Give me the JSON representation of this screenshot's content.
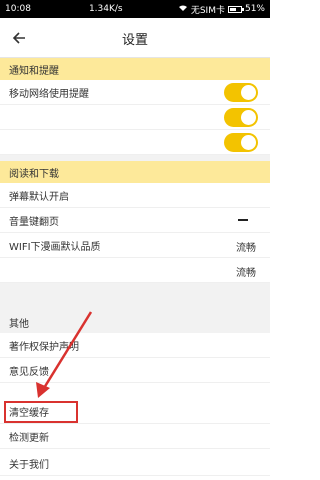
{
  "status_bar": {
    "time": "10:08",
    "network": "1.34K/s",
    "carrier": "无SIM卡",
    "battery": "51%",
    "battery_level": 0.51
  },
  "header": {
    "title": "设置",
    "back_icon": "back-arrow-icon"
  },
  "sections": {
    "notifications": {
      "header": "通知和提醒",
      "items": [
        {
          "label": "移动网络使用提醒",
          "toggle": true
        },
        {
          "label": "",
          "toggle": true
        },
        {
          "label": "",
          "toggle": true
        }
      ]
    },
    "reading": {
      "header": "阅读和下载",
      "items": [
        {
          "label": "弹幕默认开启",
          "value": ""
        },
        {
          "label": "音量键翻页",
          "value": ""
        },
        {
          "label": "WIFI下漫画默认品质",
          "value": "流畅"
        },
        {
          "label": "",
          "value": "流畅"
        }
      ]
    },
    "other": {
      "header": "其他",
      "items": [
        {
          "label": "著作权保护声明"
        },
        {
          "label": "意见反馈"
        },
        {
          "label": "清空缓存"
        },
        {
          "label": "检测更新"
        },
        {
          "label": "关于我们"
        }
      ]
    }
  },
  "colors": {
    "accent_yellow": "#f3c300",
    "section_bg": "#fde99a",
    "annotation_red": "#d9322f"
  }
}
